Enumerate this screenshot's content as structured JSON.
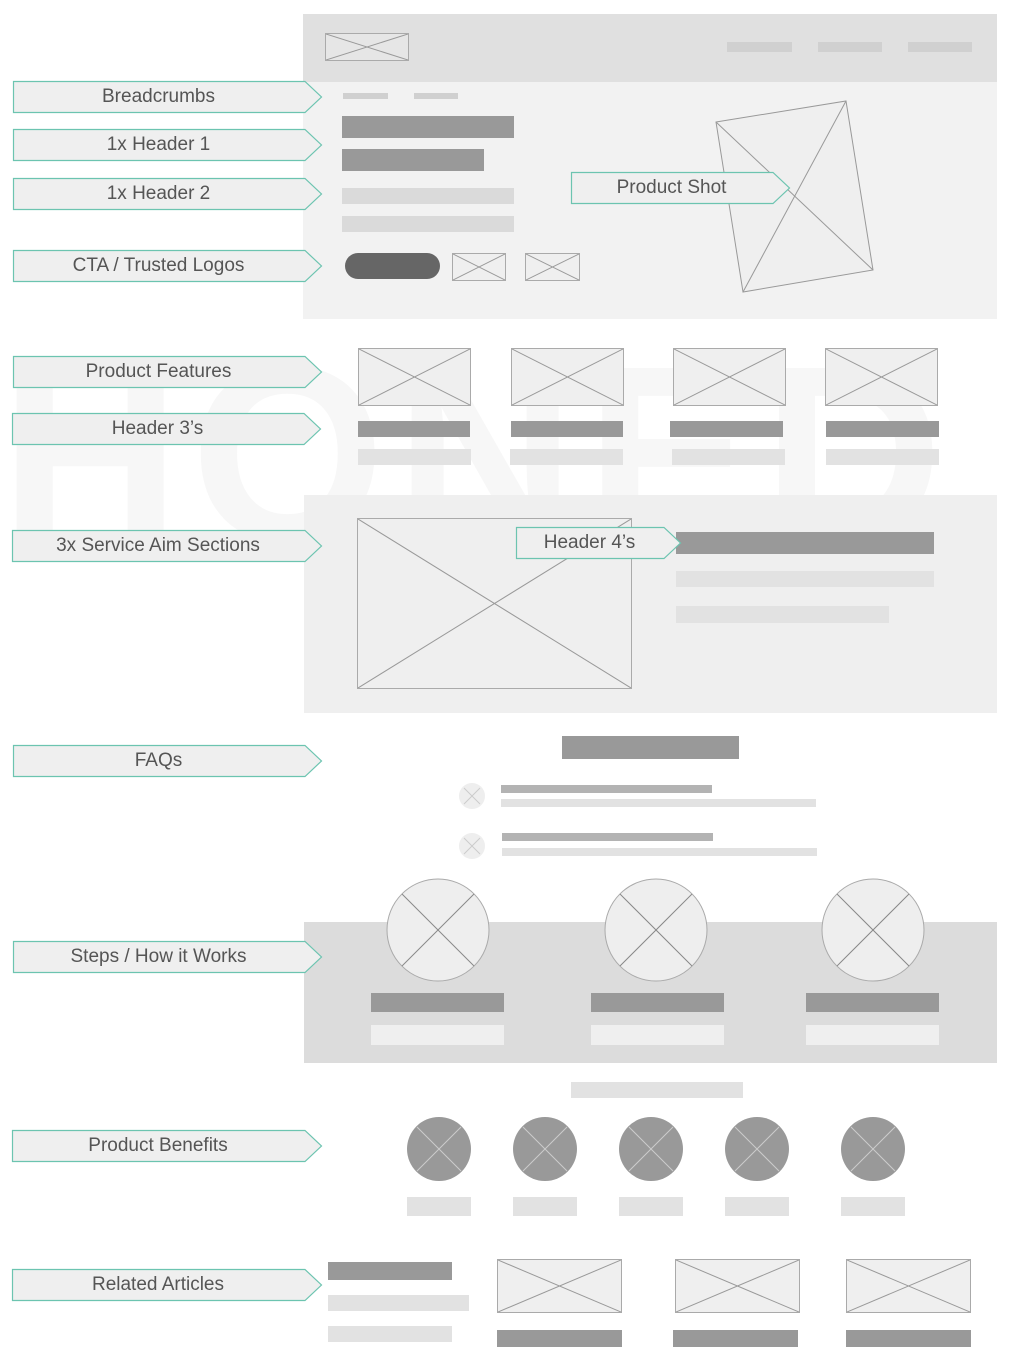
{
  "watermark": "HONED",
  "colors": {
    "label_border": "#6cc4b0",
    "label_fill": "#efefef",
    "dark_bar": "#999999",
    "light_bar": "#dadada",
    "cta": "#666666"
  },
  "labels": {
    "breadcrumbs": "Breadcrumbs",
    "header1": "1x Header 1",
    "header2": "1x Header 2",
    "cta": "CTA / Trusted Logos",
    "product_shot": "Product Shot",
    "product_features": "Product Features",
    "header3": "Header 3’s",
    "service": "3x Service Aim Sections",
    "header4": "Header 4’s",
    "faqs": "FAQs",
    "steps": "Steps / How it Works",
    "benefits": "Product Benefits",
    "related": "Related Articles"
  }
}
